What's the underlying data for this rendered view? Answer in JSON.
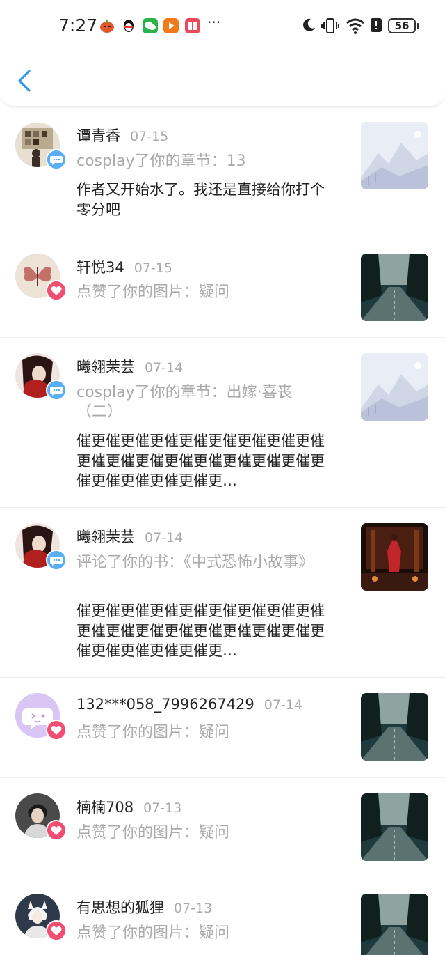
{
  "status_bar": {
    "time": "7:27",
    "overflow": "···",
    "battery": "56"
  },
  "nav": {
    "back_icon": "chevron-left-icon"
  },
  "colors": {
    "accent": "#2f9be8",
    "comment_badge": "#5aaef5",
    "like_badge": "#f24e72",
    "secondary_text": "#aaaaaa"
  },
  "notifications": [
    {
      "user": "谭青香",
      "date": "07-15",
      "badge": "comment",
      "action": "cosplay了你的章节：13",
      "content": "作者又开始水了。我还是直接给你打个零分吧",
      "thumbnail": "placeholder-mountain"
    },
    {
      "user": "轩悦34",
      "date": "07-15",
      "badge": "like",
      "action": "点赞了你的图片：疑问",
      "content": "",
      "thumbnail": "forest-road"
    },
    {
      "user": "曦翎茉芸",
      "date": "07-14",
      "badge": "comment",
      "action": "cosplay了你的章节：出嫁·喜丧（二）",
      "content": "催更催更催更催更催更催更催更催更催更催更催更催更催更催更催更催更催更催更催更催更催更催更…",
      "thumbnail": "placeholder-mountain"
    },
    {
      "user": "曦翎茉芸",
      "date": "07-14",
      "badge": "comment",
      "action": "评论了你的书：《中式恐怖小故事》",
      "content": "催更催更催更催更催更催更催更催更催更催更催更催更催更催更催更催更催更催更催更催更催更催更…",
      "thumbnail": "red-hall"
    },
    {
      "user": "132***058_7996267429",
      "date": "07-14",
      "badge": "like",
      "action": "点赞了你的图片：疑问",
      "content": "",
      "thumbnail": "forest-road"
    },
    {
      "user": "楠楠708",
      "date": "07-13",
      "badge": "like",
      "action": "点赞了你的图片：疑问",
      "content": "",
      "thumbnail": "forest-road"
    },
    {
      "user": "有思想的狐狸",
      "date": "07-13",
      "badge": "like",
      "action": "点赞了你的图片：疑问",
      "content": "",
      "thumbnail": "forest-road"
    }
  ]
}
